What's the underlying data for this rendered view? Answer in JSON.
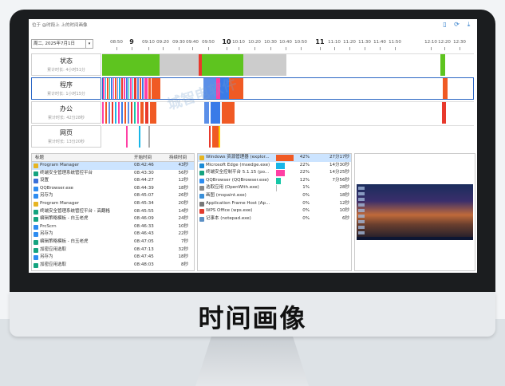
{
  "screen": {
    "hint_text": "位于 @时段上 上的时间画像",
    "date_select": "周二, 2025年7月1日",
    "icons": [
      "book-icon",
      "refresh-icon",
      "download-icon"
    ]
  },
  "axis": {
    "ticks": [
      "08:50",
      "9",
      "09:10",
      "09:20",
      "09:30",
      "09:40",
      "09:50",
      "10",
      "10:10",
      "10:20",
      "10:30",
      "10:40",
      "10:50",
      "11",
      "11:10",
      "11:20",
      "11:30",
      "11:40",
      "11:50",
      "12:10",
      "12:20",
      "12:30"
    ],
    "major": [
      "9",
      "10",
      "11"
    ]
  },
  "rows": [
    {
      "title": "状态",
      "subtitle": "累计时长: 4小时51分",
      "selected": false
    },
    {
      "title": "程序",
      "subtitle": "累计时长: 1小时15分",
      "selected": true
    },
    {
      "title": "办公",
      "subtitle": "累计时长: 42分28秒",
      "selected": false
    },
    {
      "title": "网页",
      "subtitle": "累计时长: 13分20秒",
      "selected": false
    }
  ],
  "watermark": "城智电软件",
  "list_headers": {
    "title": "标题",
    "start": "开始时间",
    "duration": "持续时间"
  },
  "events": [
    {
      "title": "Program Manager",
      "start": "08:42:46",
      "duration": "43秒",
      "icon_color": "#e6b422",
      "selected": true
    },
    {
      "title": "终端安全管理系统管控平台",
      "start": "08:43:30",
      "duration": "56秒",
      "icon_color": "#14a37f",
      "selected": false
    },
    {
      "title": "设置",
      "start": "08:44:27",
      "duration": "12秒",
      "icon_color": "#3a6fd8",
      "selected": false
    },
    {
      "title": "QQBrowser.exe",
      "start": "08:44:39",
      "duration": "18秒",
      "icon_color": "#2d8cf0",
      "selected": false
    },
    {
      "title": "另存为",
      "start": "08:45:07",
      "duration": "26秒",
      "icon_color": "#2d8cf0",
      "selected": false
    },
    {
      "title": "Program Manager",
      "start": "08:45:34",
      "duration": "20秒",
      "icon_color": "#e6b422",
      "selected": false
    },
    {
      "title": "终端安全管理系统管控平台 - 高翻格",
      "start": "08:45:55",
      "duration": "14秒",
      "icon_color": "#14a37f",
      "selected": false
    },
    {
      "title": "编辑策略模板 - 白玉老虎",
      "start": "08:46:09",
      "duration": "24秒",
      "icon_color": "#14a37f",
      "selected": false
    },
    {
      "title": "PrcScrn",
      "start": "08:46:33",
      "duration": "10秒",
      "icon_color": "#2d8cf0",
      "selected": false
    },
    {
      "title": "另存为",
      "start": "08:46:43",
      "duration": "22秒",
      "icon_color": "#2d8cf0",
      "selected": false
    },
    {
      "title": "编辑策略模板 - 白玉老虎",
      "start": "08:47:05",
      "duration": "7秒",
      "icon_color": "#14a37f",
      "selected": false
    },
    {
      "title": "加密应用选取",
      "start": "08:47:13",
      "duration": "32秒",
      "icon_color": "#14a37f",
      "selected": false
    },
    {
      "title": "另存为",
      "start": "08:47:45",
      "duration": "18秒",
      "icon_color": "#2d8cf0",
      "selected": false
    },
    {
      "title": "加密应用选取",
      "start": "08:48:03",
      "duration": "8秒",
      "icon_color": "#14a37f",
      "selected": false
    }
  ],
  "programs": [
    {
      "name": "Windows 资源管理器 (explor...",
      "percent": "42%",
      "duration": "27分17秒",
      "bar": 1.0,
      "color": "#f05a24",
      "icon_color": "#e6b422",
      "selected": true
    },
    {
      "name": "Microsoft Edge (msedge.exe)",
      "percent": "22%",
      "duration": "14分30秒",
      "bar": 0.52,
      "color": "#17b6e8",
      "icon_color": "#1a8ad6",
      "selected": false
    },
    {
      "name": "终端安全控制平台 5.1.15 (po...",
      "percent": "22%",
      "duration": "14分25秒",
      "bar": 0.52,
      "color": "#ff3fa4",
      "icon_color": "#14a37f",
      "selected": false
    },
    {
      "name": "QQBrowser (QQBrowser.exe)",
      "percent": "12%",
      "duration": "7分56秒",
      "bar": 0.29,
      "color": "#15c6a6",
      "icon_color": "#2d8cf0",
      "selected": false
    },
    {
      "name": "选取应用 (OpenWith.exe)",
      "percent": "1%",
      "duration": "28秒",
      "bar": 0.03,
      "color": "#bbbbbb",
      "icon_color": "#888888",
      "selected": false
    },
    {
      "name": "画图 (mspaint.exe)",
      "percent": "0%",
      "duration": "18秒",
      "bar": 0.0,
      "color": "#bbbbbb",
      "icon_color": "#3a8fd8",
      "selected": false
    },
    {
      "name": "Application Frame Host (Ap...",
      "percent": "0%",
      "duration": "12秒",
      "bar": 0.0,
      "color": "#bbbbbb",
      "icon_color": "#777777",
      "selected": false
    },
    {
      "name": "WPS Office (wps.exe)",
      "percent": "0%",
      "duration": "10秒",
      "bar": 0.0,
      "color": "#bbbbbb",
      "icon_color": "#e23b2e",
      "selected": false
    },
    {
      "name": "记事本 (notepad.exe)",
      "percent": "0%",
      "duration": "6秒",
      "bar": 0.0,
      "color": "#bbbbbb",
      "icon_color": "#5b8fc4",
      "selected": false
    }
  ],
  "caption": "时间画像"
}
